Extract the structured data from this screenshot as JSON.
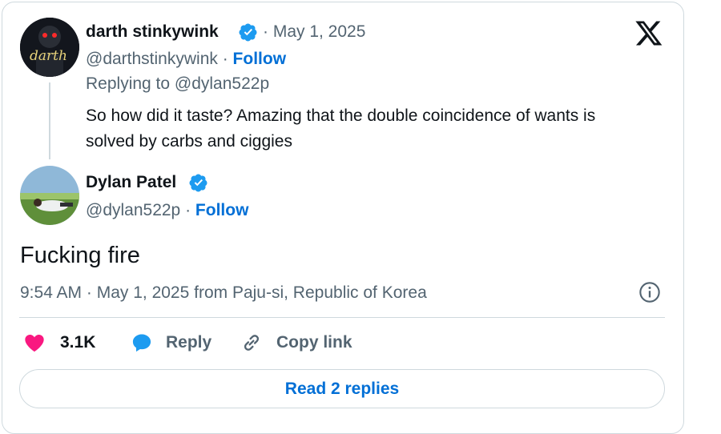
{
  "tweet_reply_parent": {
    "display_name": "darth stinkywink",
    "date": "May 1, 2025",
    "handle": "@darthstinkywink",
    "follow_label": "Follow",
    "replying_to": "Replying to @dylan522p",
    "text_line1": "So how did it taste? Amazing that the double coincidence of wants is",
    "text_line2": "solved by carbs and ciggies",
    "avatar_text": "darth"
  },
  "tweet_main": {
    "display_name": "Dylan Patel",
    "handle": "@dylan522p",
    "follow_label": "Follow",
    "text": "Fucking fire",
    "meta": "9:54 AM · May 1, 2025 from Paju-si, Republic of Korea"
  },
  "actions": {
    "likes": "3.1K",
    "reply_label": "Reply",
    "copy_link_label": "Copy link"
  },
  "read_replies_label": "Read 2 replies",
  "icons": {
    "verified": "verified-badge-icon",
    "x_logo": "x-logo-icon",
    "heart": "heart-icon",
    "reply": "reply-bubble-icon",
    "link": "link-icon",
    "info": "info-icon"
  },
  "colors": {
    "accent_blue": "#006fd6",
    "verified_blue": "#1d9bf0",
    "heart_pink": "#f91880",
    "muted": "#536471",
    "border": "#cfd9de"
  }
}
